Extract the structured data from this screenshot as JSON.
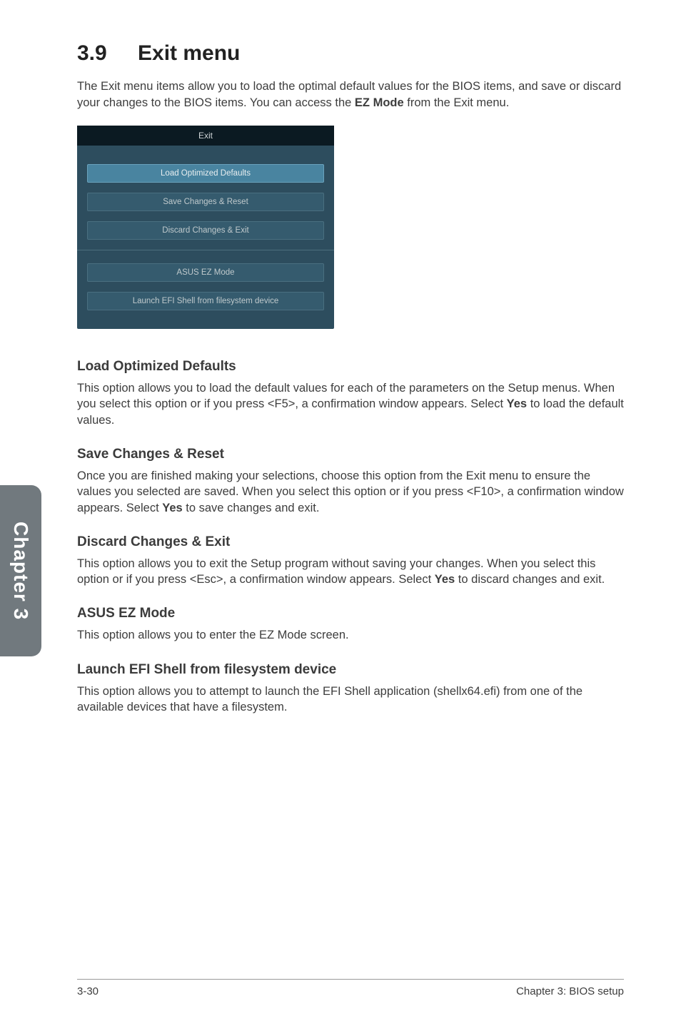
{
  "sideTab": "Chapter 3",
  "heading": {
    "num": "3.9",
    "title": "Exit menu"
  },
  "intro": {
    "p1a": "The Exit menu items allow you to load the optimal default values for the BIOS items, and save or discard your changes to the BIOS items. You can access the ",
    "p1bold": "EZ Mode",
    "p1b": " from the Exit menu."
  },
  "bios": {
    "title": "Exit",
    "btn1": "Load Optimized Defaults",
    "btn2": "Save Changes & Reset",
    "btn3": "Discard Changes & Exit",
    "btn4": "ASUS EZ Mode",
    "btn5": "Launch EFI Shell from filesystem device"
  },
  "sections": {
    "loadDefaults": {
      "heading": "Load Optimized Defaults",
      "b1": "This option allows you to load the default values for each of the parameters on the Setup menus. When you select this option or if you press <F5>, a confirmation window appears. Select ",
      "bold": "Yes",
      "b2": " to load the default values."
    },
    "saveReset": {
      "heading": "Save Changes & Reset",
      "b1": "Once you are finished making your selections, choose this option from the Exit menu to ensure the values you selected are saved. When you select this option or if you press <F10>, a confirmation window appears. Select ",
      "bold": "Yes",
      "b2": " to save changes and exit."
    },
    "discardExit": {
      "heading": "Discard Changes & Exit",
      "b1": "This option allows you to exit the Setup program without saving your changes. When you select this option or if you press <Esc>, a confirmation window appears. Select ",
      "bold": "Yes",
      "b2": " to discard changes and exit."
    },
    "ezMode": {
      "heading": "ASUS EZ Mode",
      "body": "This option allows you to enter the EZ Mode screen."
    },
    "efiShell": {
      "heading": "Launch EFI Shell from filesystem device",
      "body": "This option allows you to attempt to launch the EFI Shell application (shellx64.efi) from one of the available devices that have a filesystem."
    }
  },
  "footer": {
    "left": "3-30",
    "right": "Chapter 3: BIOS setup"
  }
}
